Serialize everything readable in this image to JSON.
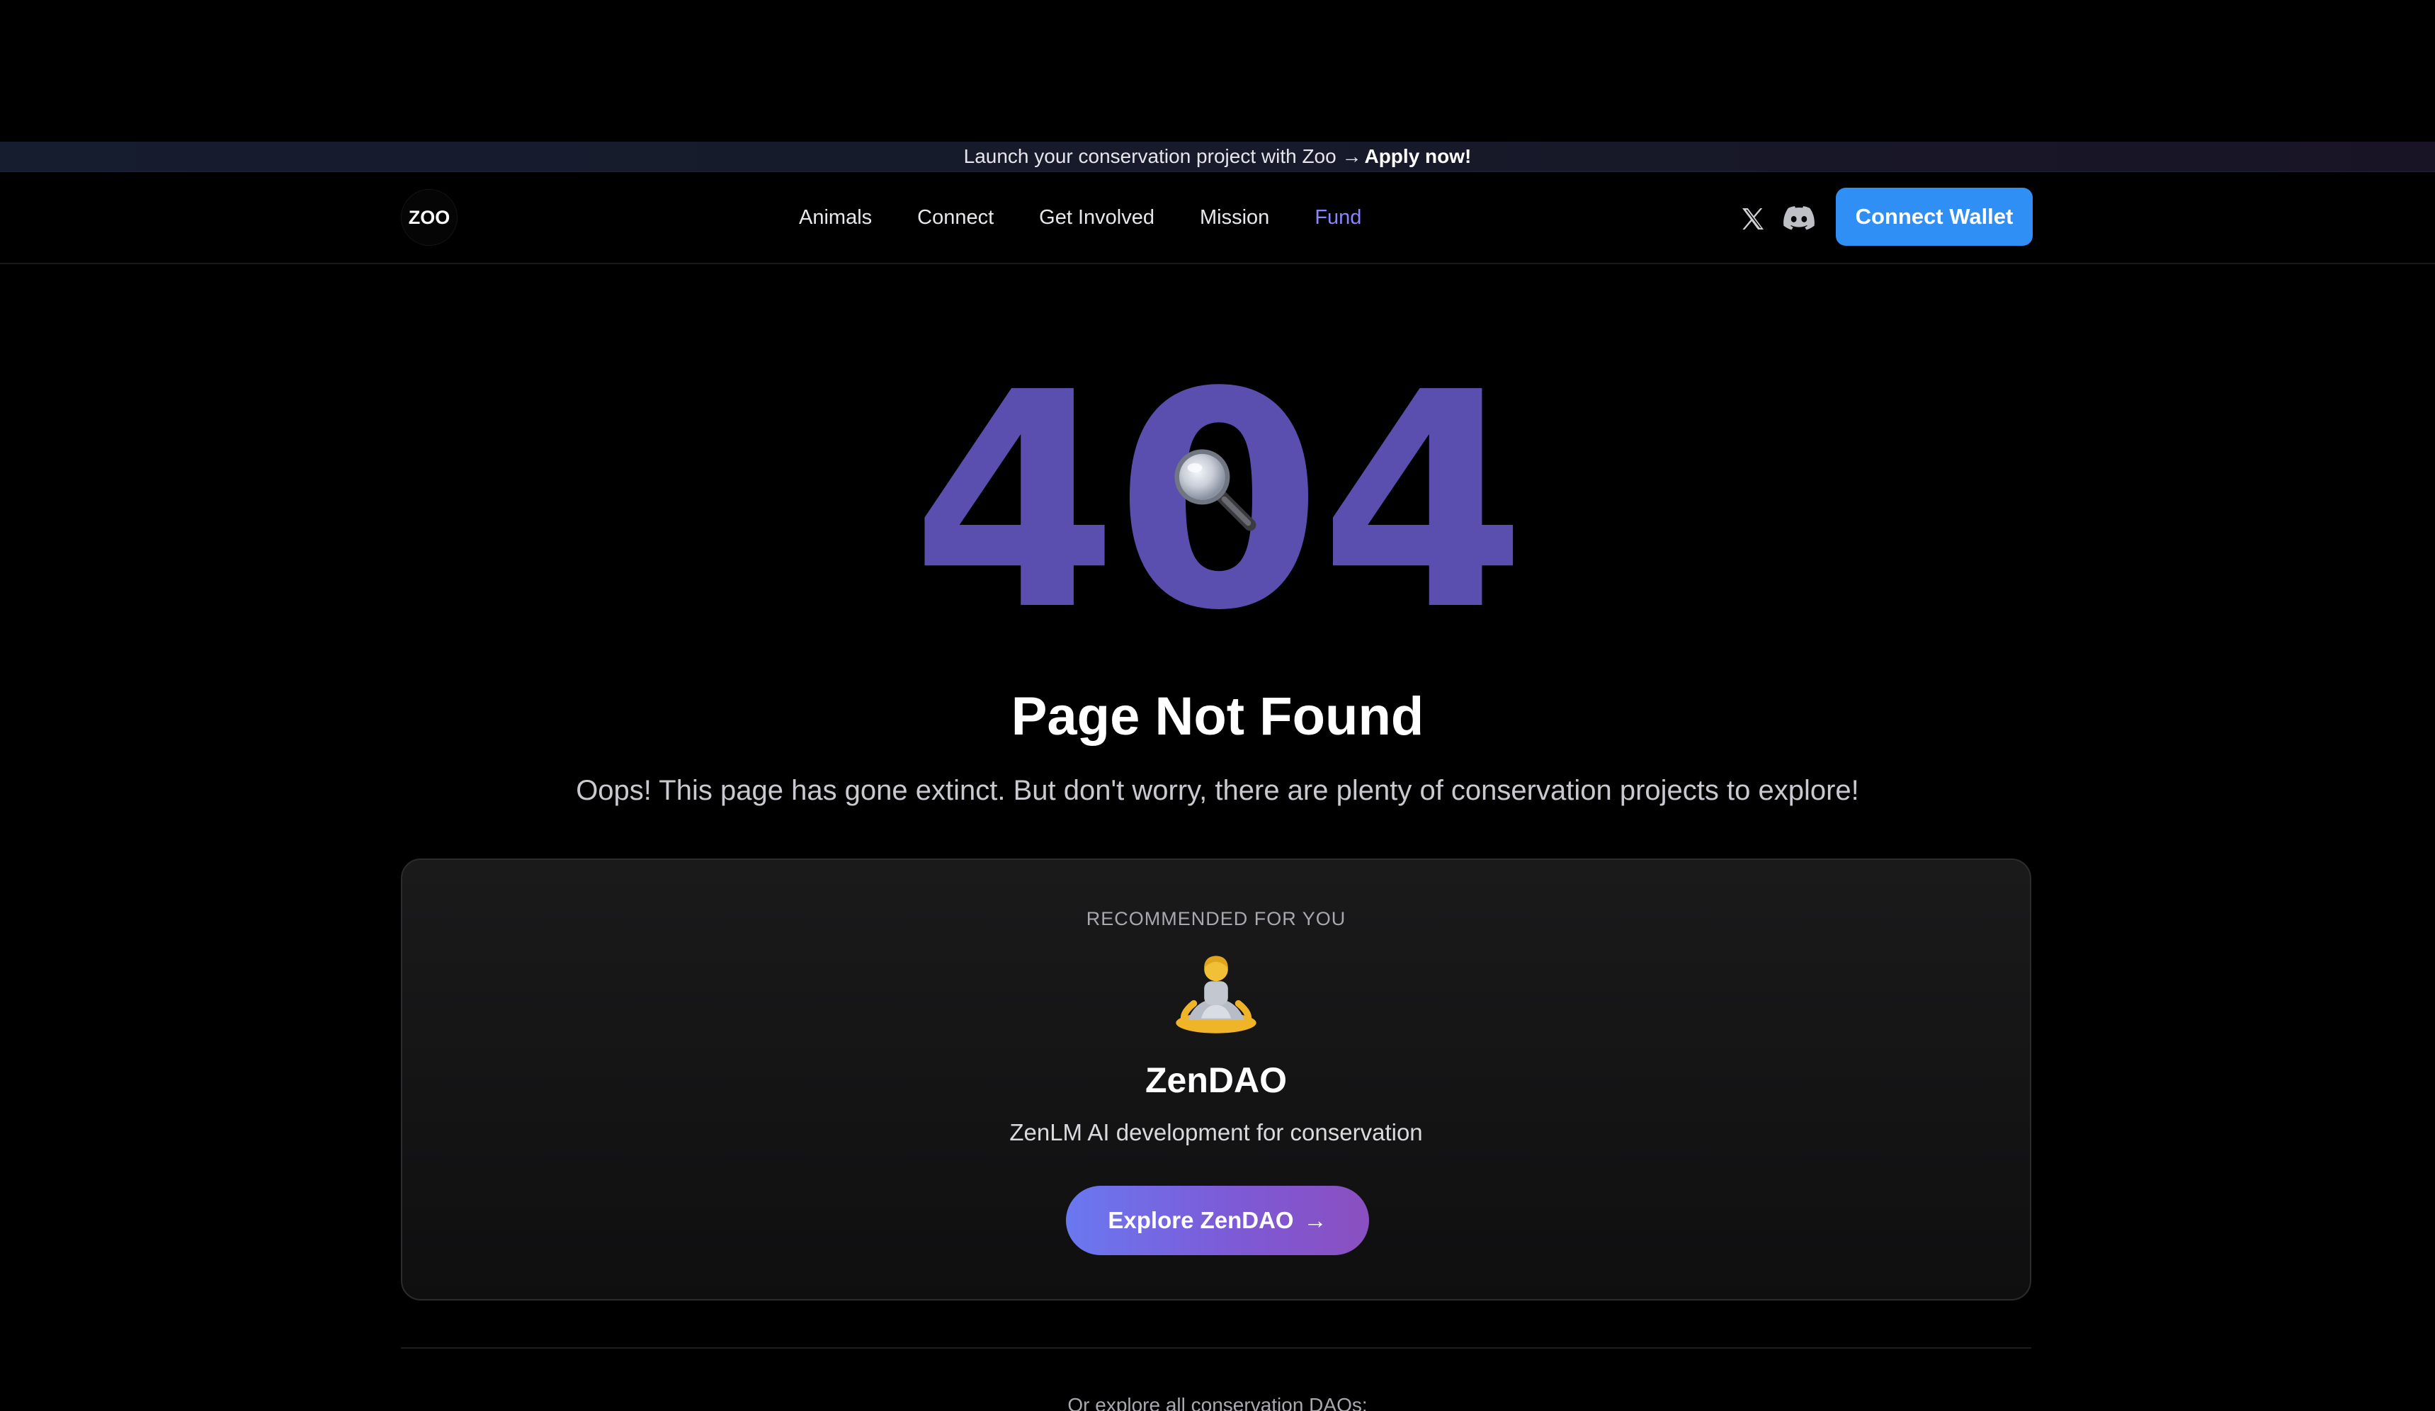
{
  "banner": {
    "text": "Launch your conservation project with Zoo →",
    "cta": "Apply now!"
  },
  "header": {
    "logo_text": "ZOO",
    "nav": [
      {
        "label": "Animals",
        "active": false
      },
      {
        "label": "Connect",
        "active": false
      },
      {
        "label": "Get Involved",
        "active": false
      },
      {
        "label": "Mission",
        "active": false
      },
      {
        "label": "Fund",
        "active": true
      }
    ],
    "social_icons": [
      "x-icon",
      "discord-icon"
    ],
    "connect_wallet_label": "Connect Wallet"
  },
  "hero": {
    "code_digits": [
      "4",
      "0",
      "4"
    ],
    "magnifier_icon": "magnifying-glass-icon",
    "title": "Page Not Found",
    "subtitle": "Oops! This page has gone extinct. But don't worry, there are plenty of conservation projects to explore!"
  },
  "recommendation": {
    "kicker": "RECOMMENDED FOR YOU",
    "icon": "person-meditating-icon",
    "name": "ZenDAO",
    "description": "ZenLM AI development for conservation",
    "button_label": "Explore ZenDAO",
    "button_arrow": "→"
  },
  "footer_hint": "Or explore all conservation DAOs:",
  "colors": {
    "background": "#000000",
    "accent_purple": "#5a4fae",
    "nav_active": "#8b85ff",
    "connect_wallet": "#2f8ff5",
    "explore_gradient_start": "#6a78f0",
    "explore_gradient_end": "#8a4fc0"
  }
}
